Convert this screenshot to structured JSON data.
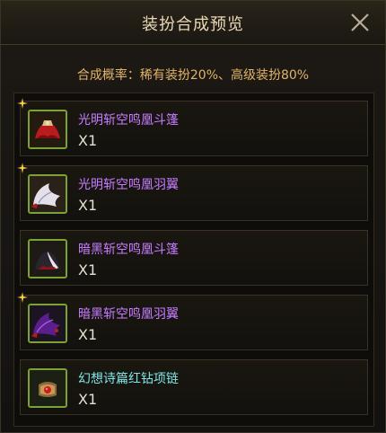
{
  "dialog": {
    "title": "装扮合成预览",
    "probability_text": "合成概率：稀有装扮20%、高级装扮80%"
  },
  "items": [
    {
      "name": "光明斩空鸣凰斗篷",
      "quantity": "X1",
      "name_color": "purple",
      "icon": "red-cape-icon"
    },
    {
      "name": "光明斩空鸣凰羽翼",
      "quantity": "X1",
      "name_color": "purple",
      "icon": "white-wings-icon"
    },
    {
      "name": "暗黑斩空鸣凰斗篷",
      "quantity": "X1",
      "name_color": "purple",
      "icon": "dark-cape-icon"
    },
    {
      "name": "暗黑斩空鸣凰羽翼",
      "quantity": "X1",
      "name_color": "purple",
      "icon": "purple-wings-icon"
    },
    {
      "name": "幻想诗篇红钻项链",
      "quantity": "X1",
      "name_color": "cyan",
      "icon": "red-gem-necklace-icon"
    }
  ],
  "colors": {
    "title": "#e9d9b4",
    "probability": "#e2b36b",
    "purple_name": "#c77cff",
    "cyan_name": "#7fe6e6",
    "icon_border": "#7aa236"
  }
}
